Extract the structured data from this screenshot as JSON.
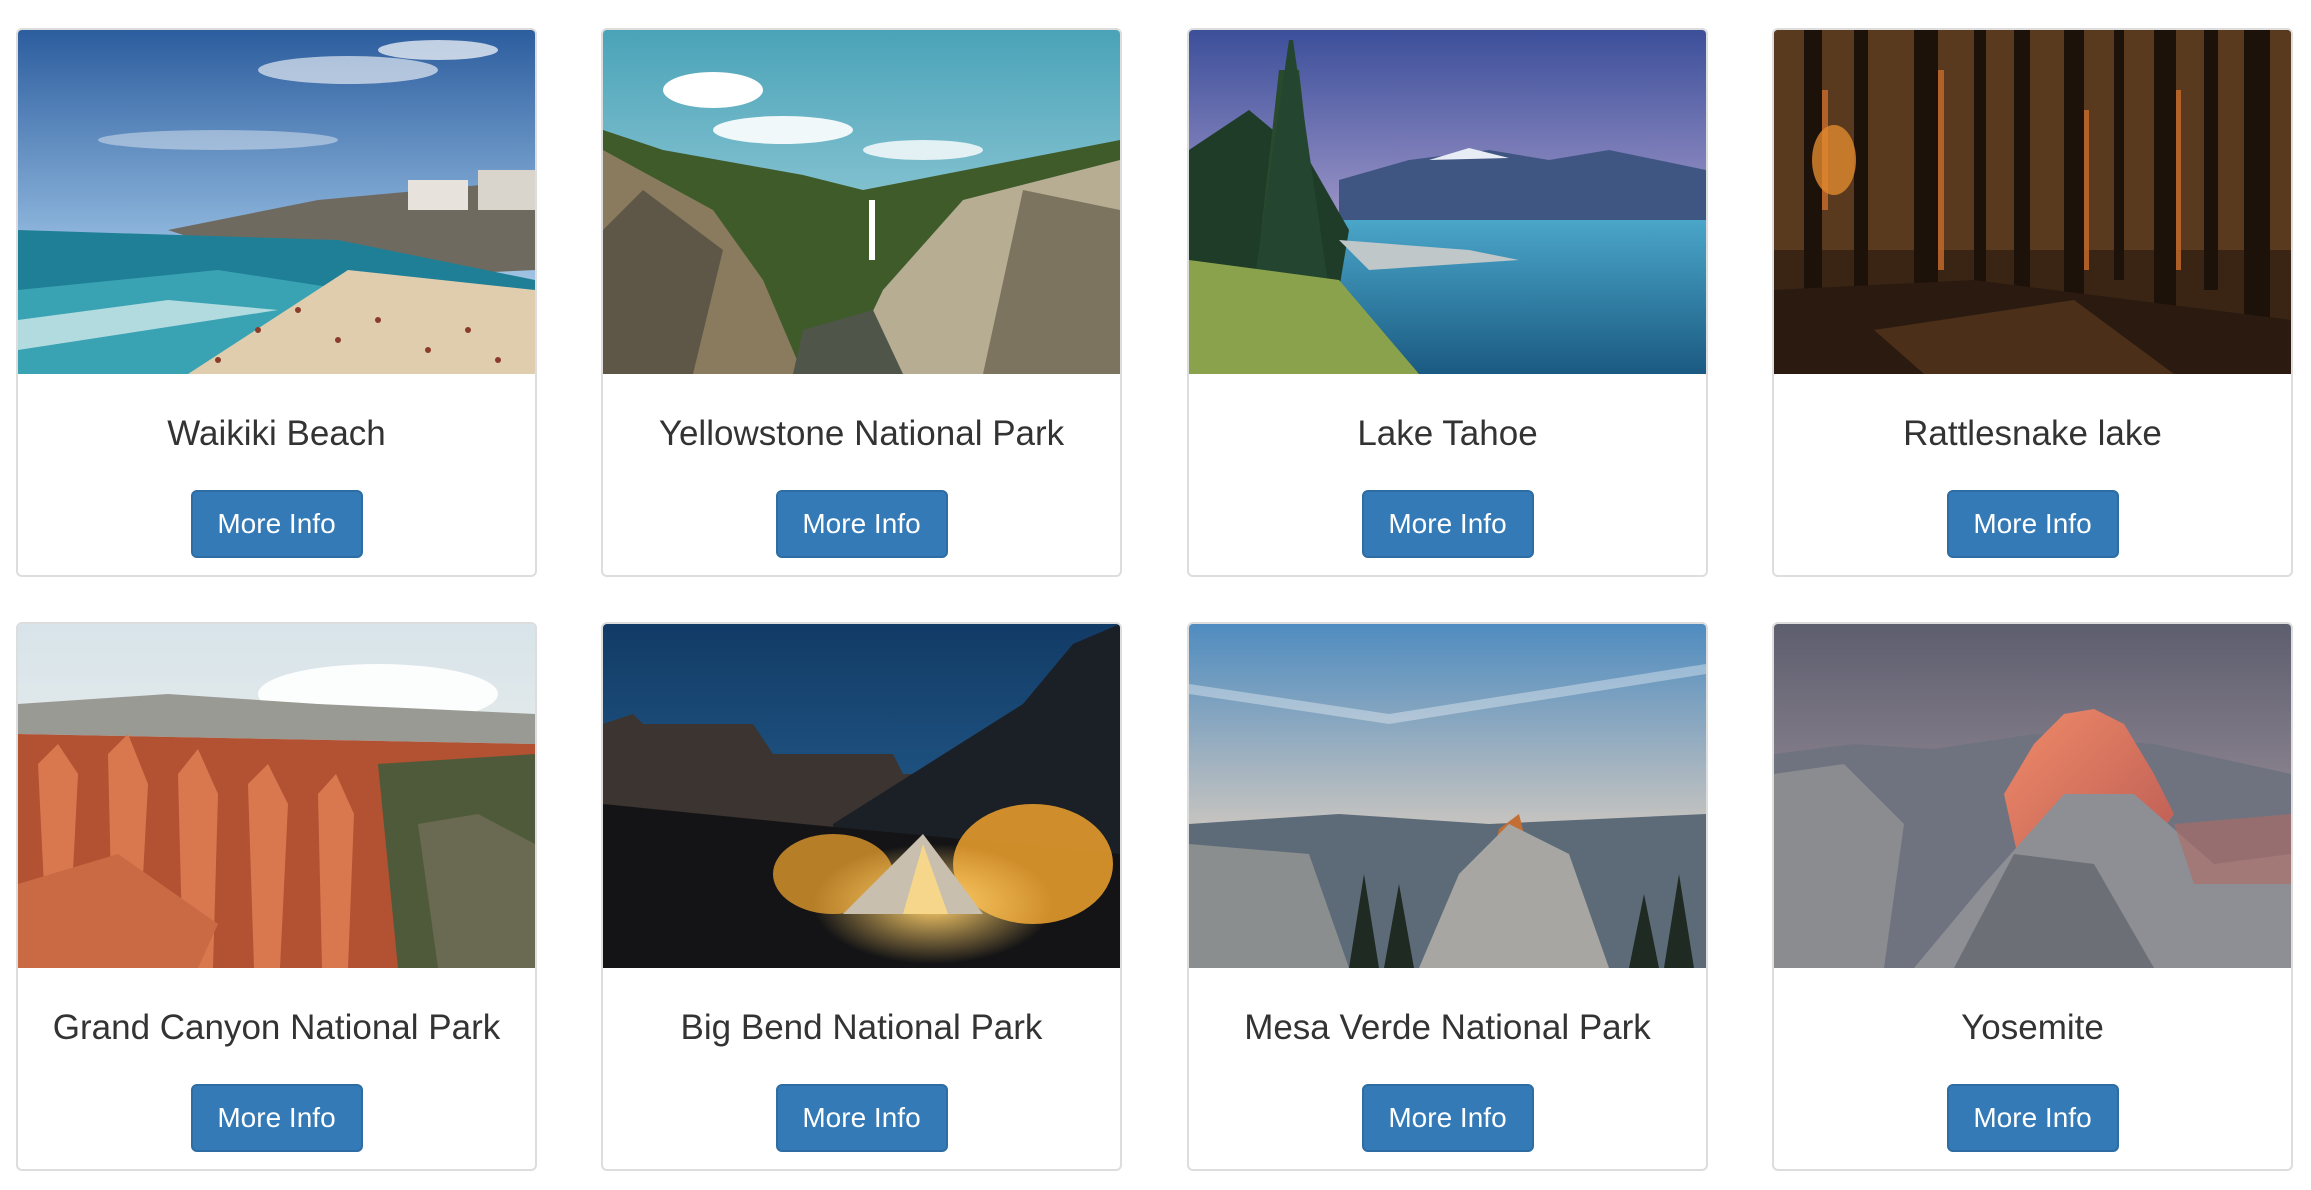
{
  "cards": [
    {
      "title": "Waikiki Beach",
      "button": "More Info",
      "image": "beach-photo"
    },
    {
      "title": "Yellowstone National Park",
      "button": "More Info",
      "image": "canyon-waterfall-photo"
    },
    {
      "title": "Lake Tahoe",
      "button": "More Info",
      "image": "lake-photo"
    },
    {
      "title": "Rattlesnake lake",
      "button": "More Info",
      "image": "forest-photo"
    },
    {
      "title": "Grand Canyon National Park",
      "button": "More Info",
      "image": "red-canyon-photo"
    },
    {
      "title": "Big Bend National Park",
      "button": "More Info",
      "image": "tent-night-photo"
    },
    {
      "title": "Mesa Verde National Park",
      "button": "More Info",
      "image": "sunset-dome-photo"
    },
    {
      "title": "Yosemite",
      "button": "More Info",
      "image": "half-dome-photo"
    }
  ],
  "colors": {
    "button": "#337ab7",
    "button_border": "#2e6da4",
    "title_text": "#333333",
    "card_border": "#dddddd"
  }
}
